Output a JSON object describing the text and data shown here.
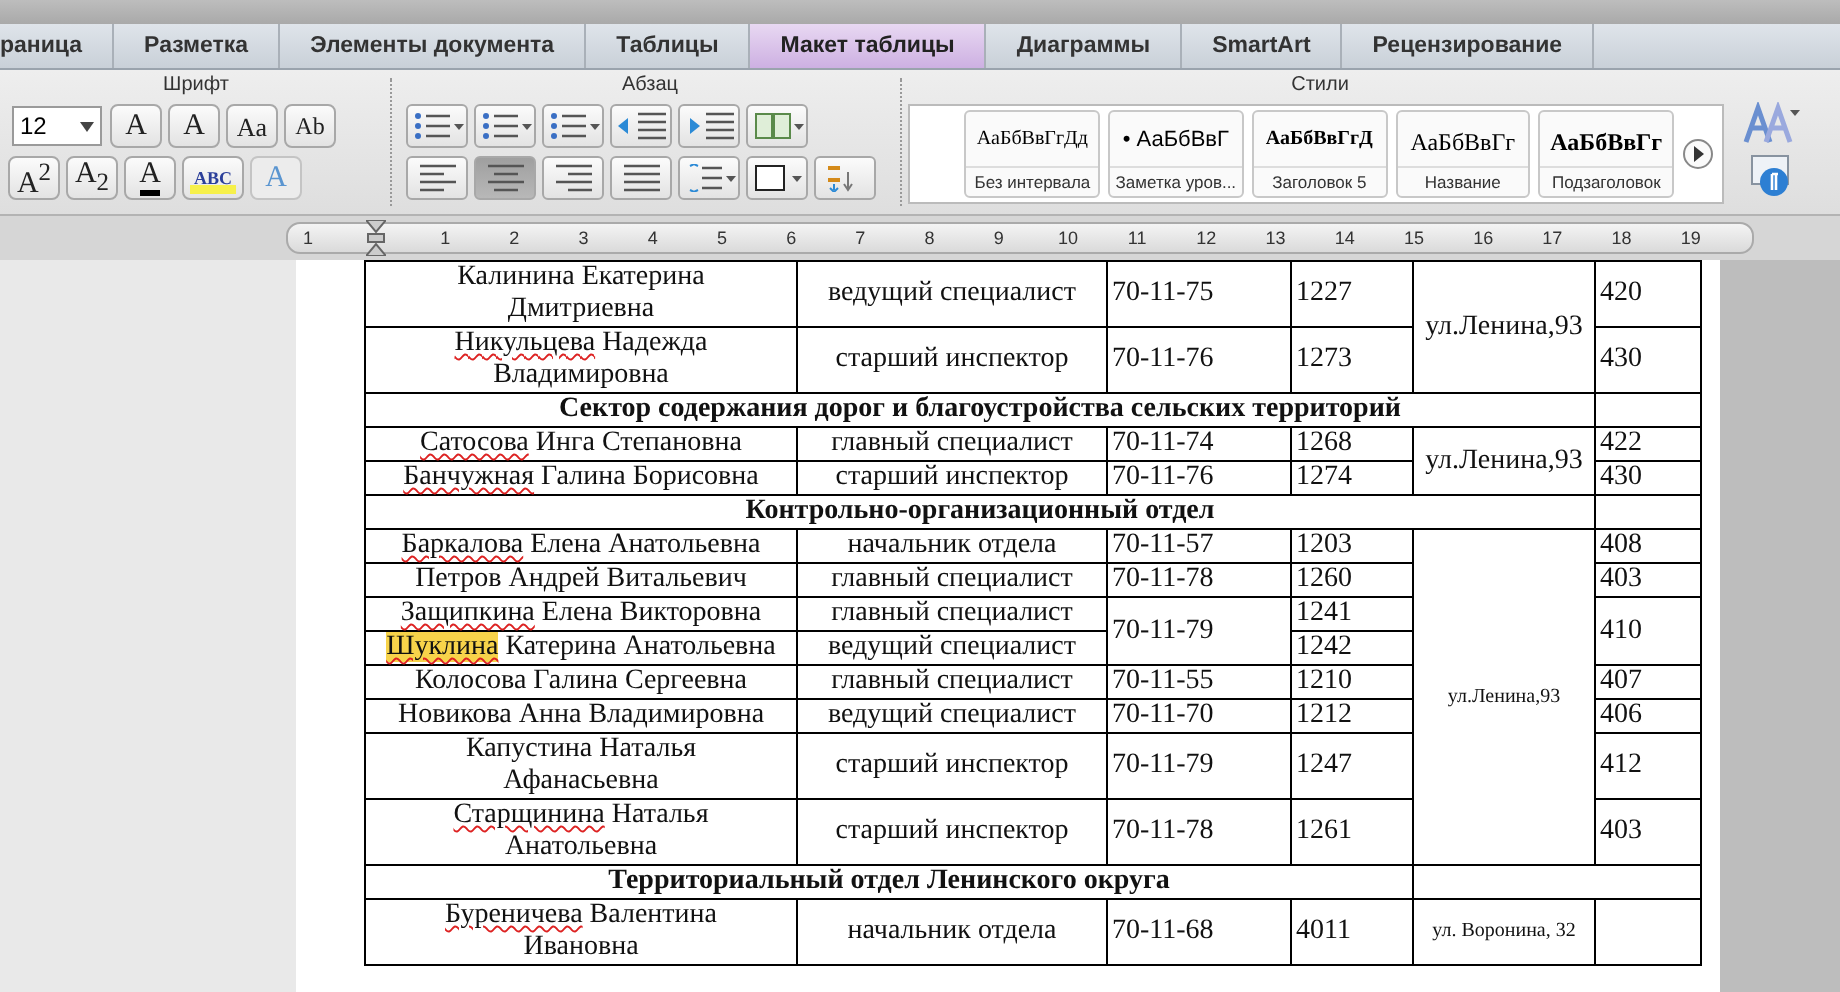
{
  "tabs": [
    {
      "label": "раница",
      "selected": false
    },
    {
      "label": "Разметка",
      "selected": false
    },
    {
      "label": "Элементы документа",
      "selected": false
    },
    {
      "label": "Таблицы",
      "selected": false
    },
    {
      "label": "Макет таблицы",
      "selected": true
    },
    {
      "label": "Диаграммы",
      "selected": false
    },
    {
      "label": "SmartArt",
      "selected": false
    },
    {
      "label": "Рецензирование",
      "selected": false
    }
  ],
  "font_group": {
    "label": "Шрифт",
    "size": "12",
    "row1": [
      {
        "kind": "grow",
        "glyph": "A",
        "disabled": false
      },
      {
        "kind": "shrink",
        "glyph": "A",
        "disabled": false
      },
      {
        "kind": "case",
        "glyph": "Aa",
        "disabled": false
      },
      {
        "kind": "clear",
        "glyph": "Ab",
        "disabled": false
      }
    ],
    "row2": [
      {
        "kind": "super",
        "glyph": "A$^{2}$",
        "disabled": false
      },
      {
        "kind": "sub",
        "glyph": "A$_{2}$",
        "disabled": false
      },
      {
        "kind": "color",
        "glyph": "A",
        "disabled": false
      },
      {
        "kind": "highlight",
        "glyph": "ABC",
        "disabled": false
      },
      {
        "kind": "effects",
        "glyph": "A",
        "disabled": true
      }
    ]
  },
  "paragraph_group": {
    "label": "Абзац",
    "row1": [
      {
        "kind": "bullets",
        "selected": false
      },
      {
        "kind": "numbering",
        "selected": false
      },
      {
        "kind": "multilevel",
        "selected": false
      },
      {
        "kind": "outdent",
        "selected": false
      },
      {
        "kind": "indent",
        "selected": false
      },
      {
        "kind": "columns",
        "selected": false
      }
    ],
    "row2": [
      {
        "kind": "align_left",
        "selected": false
      },
      {
        "kind": "align_center",
        "selected": true
      },
      {
        "kind": "align_right",
        "selected": false
      },
      {
        "kind": "justify",
        "selected": false
      },
      {
        "kind": "spacing",
        "selected": false
      },
      {
        "kind": "borders",
        "selected": false
      },
      {
        "kind": "sort",
        "selected": false
      }
    ]
  },
  "styles_group": {
    "label": "Стили",
    "items": [
      {
        "kind": "plain",
        "preview": "АаБбВвГгДд",
        "name": "Без интервала"
      },
      {
        "kind": "bullet",
        "preview": "• АаБбВвГ",
        "name": "Заметка уров..."
      },
      {
        "kind": "heading",
        "preview": "АаБбВвГгД",
        "name": "Заголовок 5"
      },
      {
        "kind": "title",
        "preview": "АаБбВвГг",
        "name": "Название"
      },
      {
        "kind": "subtitle",
        "preview": "АаБбВвГг",
        "name": "Подзаголовок"
      }
    ]
  },
  "ruler": {
    "labels": [
      "1",
      "1",
      "2",
      "3",
      "4",
      "5",
      "6",
      "7",
      "8",
      "9",
      "10",
      "11",
      "12",
      "13",
      "14",
      "15",
      "16",
      "17",
      "18",
      "19"
    ]
  },
  "table": {
    "rows": [
      {
        "kind": "person",
        "surname": "Калинина",
        "given": "Екатерина",
        "patronymic": "Дмитриевна",
        "wrapped": true,
        "misspelled": false,
        "highlighted": false,
        "position": "ведущий специалист",
        "phone": "70-11-75",
        "ext": "1227",
        "address": "ул.Ленина,93",
        "address_small": false,
        "room": "420"
      },
      {
        "kind": "person",
        "surname": "Никульцева",
        "given": "Надежда",
        "patronymic": "Владимировна",
        "wrapped": true,
        "misspelled": true,
        "highlighted": false,
        "position": "старший инспектор",
        "phone": "70-11-76",
        "ext": "1273",
        "room": "430"
      },
      {
        "kind": "section",
        "title": "Сектор содержания дорог и благоустройства сельских территорий",
        "covers_address": true
      },
      {
        "kind": "person",
        "surname": "Сатосова",
        "given": "Инга",
        "patronymic": "Степановна",
        "wrapped": false,
        "misspelled": true,
        "highlighted": false,
        "position": "главный специалист",
        "phone": "70-11-74",
        "ext": "1268",
        "address": "ул.Ленина,93",
        "address_small": false,
        "room": "422"
      },
      {
        "kind": "person",
        "surname": "Банчужная",
        "given": "Галина",
        "patronymic": "Борисовна",
        "wrapped": false,
        "misspelled": true,
        "highlighted": false,
        "position": "старший инспектор",
        "phone": "70-11-76",
        "ext": "1274",
        "room": "430"
      },
      {
        "kind": "section",
        "title": "Контрольно-организационный отдел",
        "covers_address": true
      },
      {
        "kind": "person",
        "surname": "Баркалова",
        "given": "Елена",
        "patronymic": "Анатольевна",
        "wrapped": false,
        "misspelled": true,
        "highlighted": false,
        "position": "начальник отдела",
        "phone": "70-11-57",
        "ext": "1203",
        "address": "ул.Ленина,93",
        "address_small": true,
        "room": "408"
      },
      {
        "kind": "person",
        "surname": "Петров",
        "given": "Андрей",
        "patronymic": "Витальевич",
        "wrapped": false,
        "misspelled": false,
        "highlighted": false,
        "position": "главный специалист",
        "phone": "70-11-78",
        "ext": "1260",
        "room": "403"
      },
      {
        "kind": "person",
        "surname": "Защипкина",
        "given": "Елена",
        "patronymic": "Викторовна",
        "wrapped": false,
        "misspelled": true,
        "highlighted": false,
        "position": "главный специалист",
        "phone": "70-11-79",
        "ext": "1241",
        "room": "410"
      },
      {
        "kind": "person",
        "surname": "Шуклина",
        "given": "Катерина",
        "patronymic": "Анатольевна",
        "wrapped": false,
        "misspelled": true,
        "highlighted": true,
        "position": "ведущий специалист",
        "ext": "1242"
      },
      {
        "kind": "person",
        "surname": "Колосова",
        "given": "Галина",
        "patronymic": "Сергеевна",
        "wrapped": false,
        "misspelled": false,
        "highlighted": false,
        "position": "главный специалист",
        "phone": "70-11-55",
        "ext": "1210",
        "room": "407"
      },
      {
        "kind": "person",
        "surname": "Новикова",
        "given": "Анна",
        "patronymic": "Владимировна",
        "wrapped": false,
        "misspelled": false,
        "highlighted": false,
        "position": "ведущий специалист",
        "phone": "70-11-70",
        "ext": "1212",
        "room": "406"
      },
      {
        "kind": "person",
        "surname": "Капустина",
        "given": "Наталья",
        "patronymic": "Афанасьевна",
        "wrapped": true,
        "misspelled": false,
        "highlighted": false,
        "position": "старший инспектор",
        "phone": "70-11-79",
        "ext": "1247",
        "room": "412"
      },
      {
        "kind": "person",
        "surname": "Старщинина",
        "given": "Наталья",
        "patronymic": "Анатольевна",
        "wrapped": true,
        "misspelled": true,
        "highlighted": false,
        "position": "старший инспектор",
        "phone": "70-11-78",
        "ext": "1261",
        "room": "403"
      },
      {
        "kind": "section",
        "title": "Территориальный отдел Ленинского округа",
        "covers_address": false
      },
      {
        "kind": "person",
        "surname": "Буреничева",
        "given": "Валентина",
        "patronymic": "Ивановна",
        "wrapped": true,
        "misspelled": true,
        "highlighted": false,
        "position": "начальник отдела",
        "phone": "70-11-68",
        "ext": "4011",
        "address": "ул. Воронина, 32",
        "address_small": true
      }
    ]
  }
}
